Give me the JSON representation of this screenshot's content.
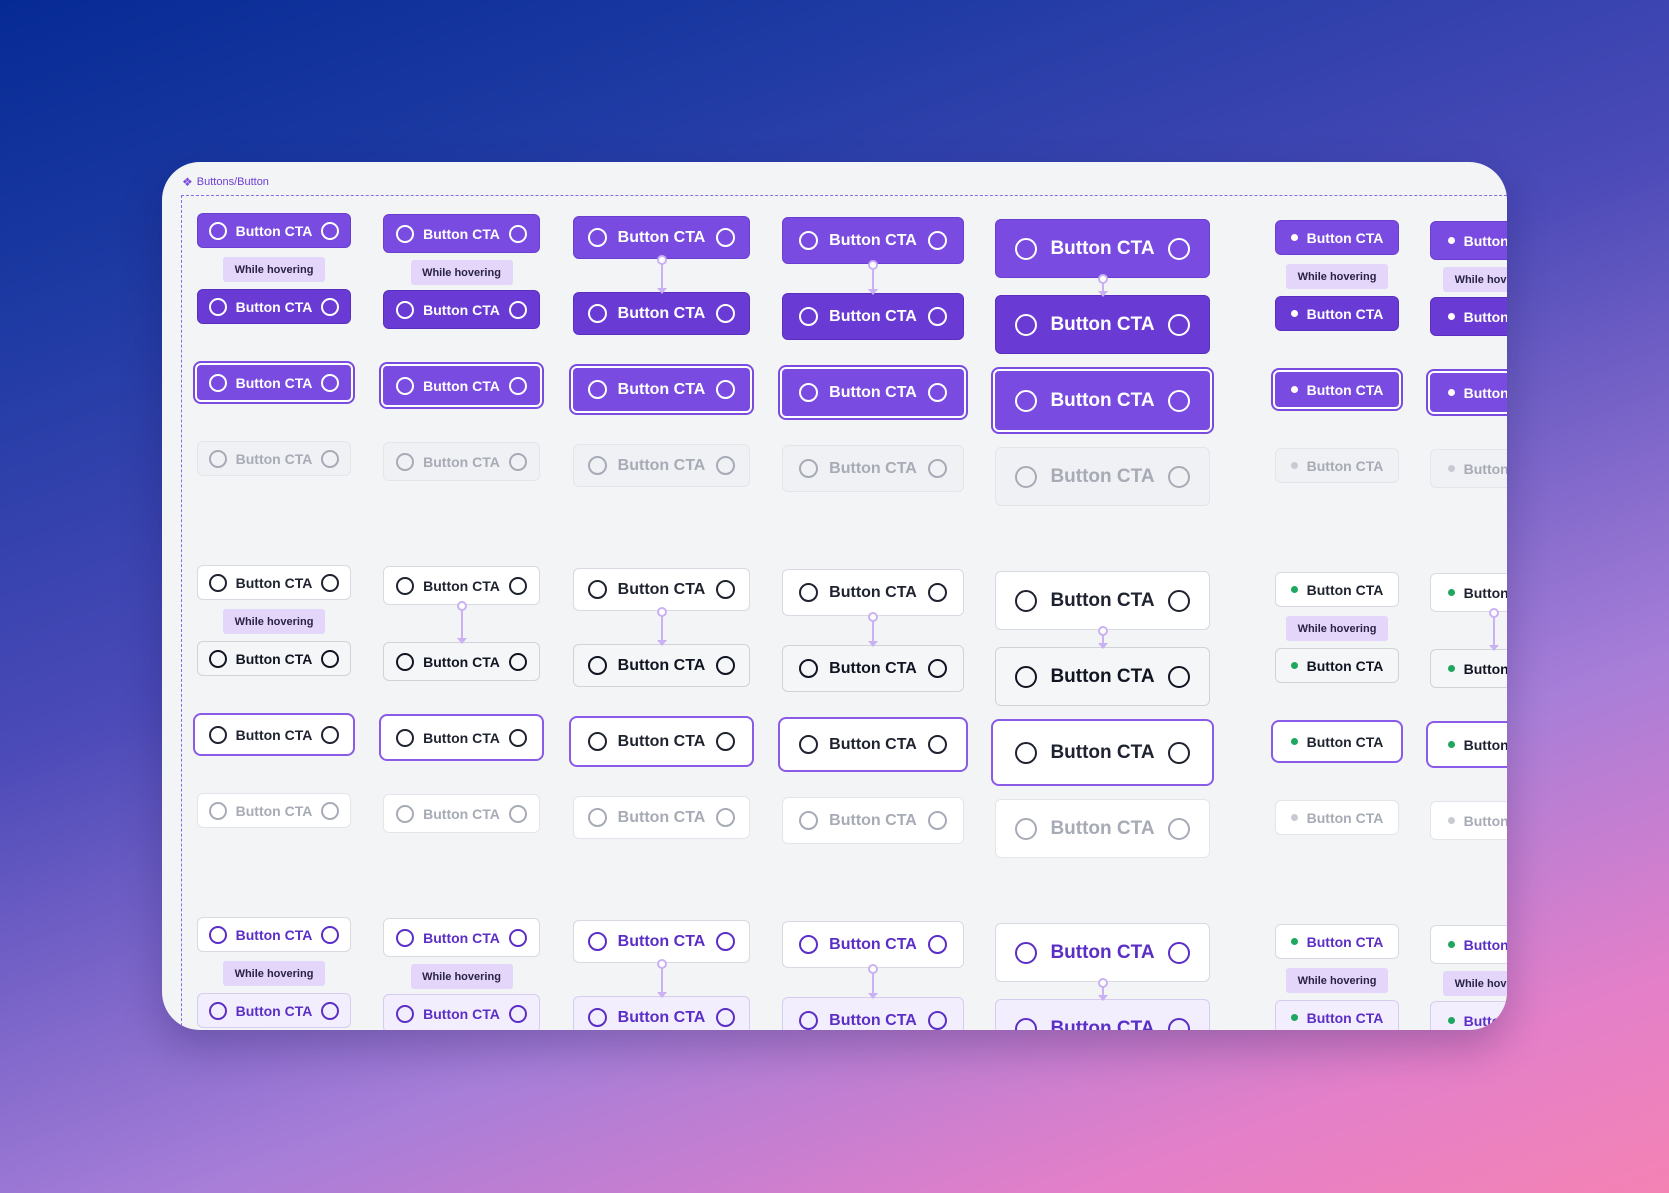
{
  "component_path": "Buttons/Button",
  "button_label": "Button CTA",
  "hover_note": "While hovering",
  "states": [
    "default",
    "hover",
    "focus",
    "disabled"
  ],
  "variants": [
    "primary",
    "secondary",
    "tertiary"
  ],
  "sizes": [
    "xs",
    "sm",
    "md",
    "lg",
    "xl",
    "dot-xs",
    "dot-sm"
  ],
  "colors": {
    "background_top": "#062a94",
    "background_bottom": "#f483b4",
    "primary": "#7a4be0",
    "primary_hover": "#6a3bd4",
    "secondary_text": "#1f2330",
    "tertiary_text": "#5b2fc6",
    "hover_tag": "#e4d6fb",
    "status_dot": "#1fa65f",
    "disabled_text": "#a7abb5"
  },
  "icons": {
    "component": "component-diamond-icon",
    "leading": "circle-icon",
    "trailing": "circle-icon",
    "dot": "status-dot-icon"
  }
}
